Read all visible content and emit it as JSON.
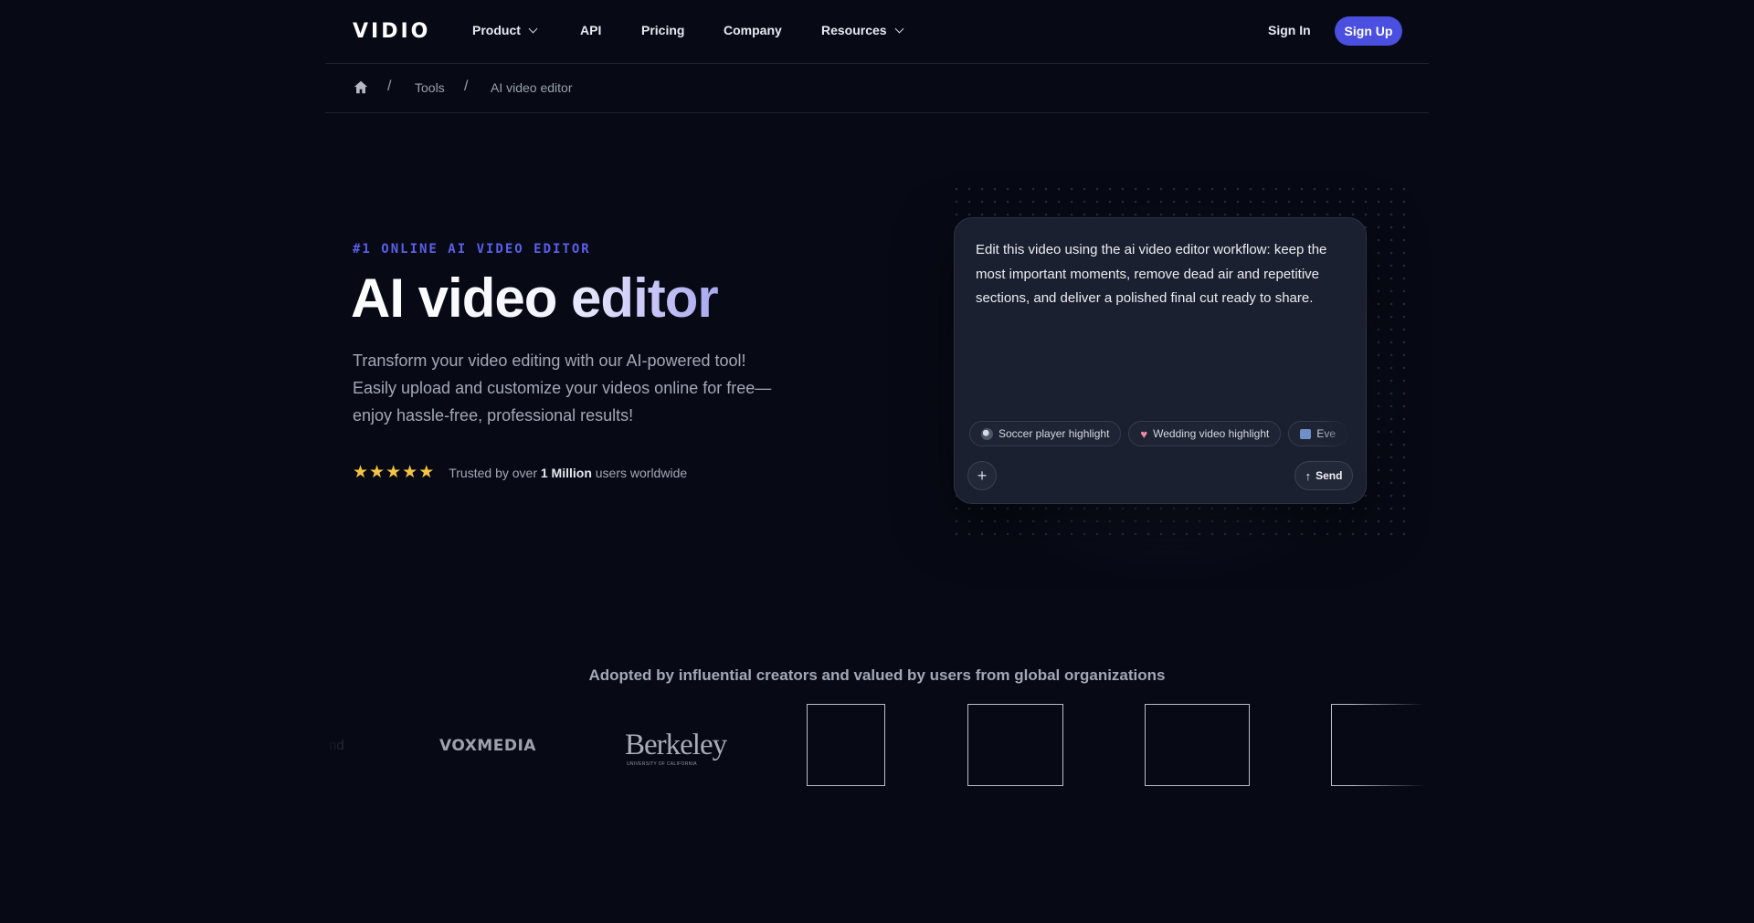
{
  "nav": {
    "brand": "VIDIO",
    "items": [
      {
        "label": "Product"
      },
      {
        "label": "API"
      },
      {
        "label": "Pricing"
      },
      {
        "label": "Company"
      },
      {
        "label": "Resources"
      }
    ],
    "sign_in": "Sign In",
    "sign_up": "Sign Up"
  },
  "breadcrumb": {
    "items": [
      "Tools",
      "AI video editor"
    ]
  },
  "hero": {
    "kicker": "#1 ONLINE AI VIDEO EDITOR",
    "title": "AI video editor",
    "subtitle": "Transform your video editing with our AI-powered tool! Easily upload and customize your videos online for free—enjoy hassle-free, professional results!",
    "trusted_prefix": "Trusted by over",
    "trusted_bold": "1 Million",
    "trusted_suffix": "users worldwide",
    "rating": 5
  },
  "prompt_card": {
    "text": "Edit this video using the ai video editor workflow: keep the most important moments, remove dead air and repetitive sections, and deliver a polished final cut ready to share.",
    "chips": [
      {
        "label": "Soccer player highlight",
        "icon": "soccer-ball-icon"
      },
      {
        "label": "Wedding video highlight",
        "icon": "heart-icon"
      },
      {
        "label": "Eve",
        "icon": "photos-icon"
      }
    ],
    "send_label": "Send"
  },
  "logos": {
    "heading": "Adopted by influential creators and valued by users from global organizations",
    "partial_text": "nd",
    "voxmedia": "VOXMEDIA",
    "berkeley": "Berkeley",
    "berkeley_sub": "UNIVERSITY OF CALIFORNIA"
  },
  "colors": {
    "background": "#070a15",
    "accent": "#4b4fe0",
    "kicker": "#5b5ee8",
    "star": "#f5c542",
    "card": "#1b2030"
  }
}
